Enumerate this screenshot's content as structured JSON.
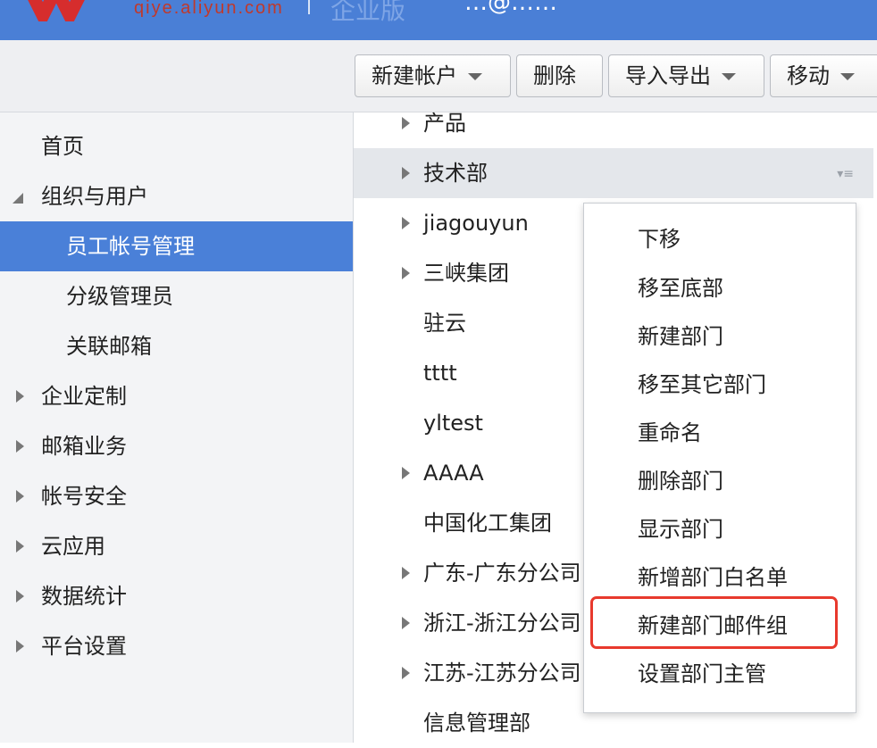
{
  "header": {
    "logo_url": "qiye.aliyun.com",
    "edition": "企业版",
    "user_partial": "…@……"
  },
  "toolbar": {
    "new_account": "新建帐户",
    "delete": "删除",
    "import_export": "导入导出",
    "move": "移动"
  },
  "sidebar": {
    "items": [
      {
        "label": "首页"
      },
      {
        "label": "组织与用户"
      },
      {
        "label": "员工帐号管理"
      },
      {
        "label": "分级管理员"
      },
      {
        "label": "关联邮箱"
      },
      {
        "label": "企业定制"
      },
      {
        "label": "邮箱业务"
      },
      {
        "label": "帐号安全"
      },
      {
        "label": "云应用"
      },
      {
        "label": "数据统计"
      },
      {
        "label": "平台设置"
      }
    ]
  },
  "tree": {
    "rows": [
      {
        "label": "产品"
      },
      {
        "label": "技术部"
      },
      {
        "label": "jiagouyun"
      },
      {
        "label": "三峡集团"
      },
      {
        "label": "驻云"
      },
      {
        "label": "tttt"
      },
      {
        "label": "yltest"
      },
      {
        "label": "AAAA"
      },
      {
        "label": "中国化工集团"
      },
      {
        "label": "广东-广东分公司"
      },
      {
        "label": "浙江-浙江分公司"
      },
      {
        "label": "江苏-江苏分公司"
      },
      {
        "label": "信息管理部"
      }
    ]
  },
  "context_menu": {
    "items": [
      {
        "label": "下移"
      },
      {
        "label": "移至底部"
      },
      {
        "label": "新建部门"
      },
      {
        "label": "移至其它部门"
      },
      {
        "label": "重命名"
      },
      {
        "label": "删除部门"
      },
      {
        "label": "显示部门"
      },
      {
        "label": "新增部门白名单"
      },
      {
        "label": "新建部门邮件组"
      },
      {
        "label": "设置部门主管"
      }
    ]
  },
  "colors": {
    "header_bg": "#4a7fd6",
    "active_bg": "#4a80d8",
    "highlight": "#e8392d"
  }
}
